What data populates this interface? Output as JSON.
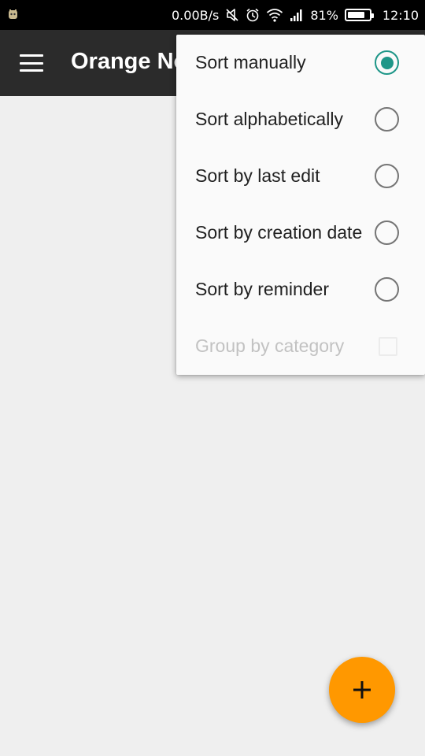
{
  "status_bar": {
    "net_speed": "0.00B/s",
    "battery_percent": "81%",
    "battery_level": 0.81,
    "time": "12:10",
    "icons": [
      "notification-icon",
      "mute-icon",
      "alarm-icon",
      "wifi-icon",
      "signal-icon",
      "battery-icon"
    ]
  },
  "toolbar": {
    "title": "Orange Notes",
    "menu_icon": "hamburger-menu-icon",
    "background": "#2b2b2b"
  },
  "sort_menu": {
    "items": [
      {
        "label": "Sort manually",
        "control": "radio",
        "checked": true
      },
      {
        "label": "Sort alphabetically",
        "control": "radio",
        "checked": false
      },
      {
        "label": "Sort by last edit",
        "control": "radio",
        "checked": false
      },
      {
        "label": "Sort by creation date",
        "control": "radio",
        "checked": false
      },
      {
        "label": "Sort by reminder",
        "control": "radio",
        "checked": false
      },
      {
        "label": "Group by category",
        "control": "checkbox",
        "checked": false,
        "disabled": true
      }
    ],
    "accent_color": "#1e9688"
  },
  "fab": {
    "icon": "plus-icon",
    "color": "#ff9800"
  }
}
